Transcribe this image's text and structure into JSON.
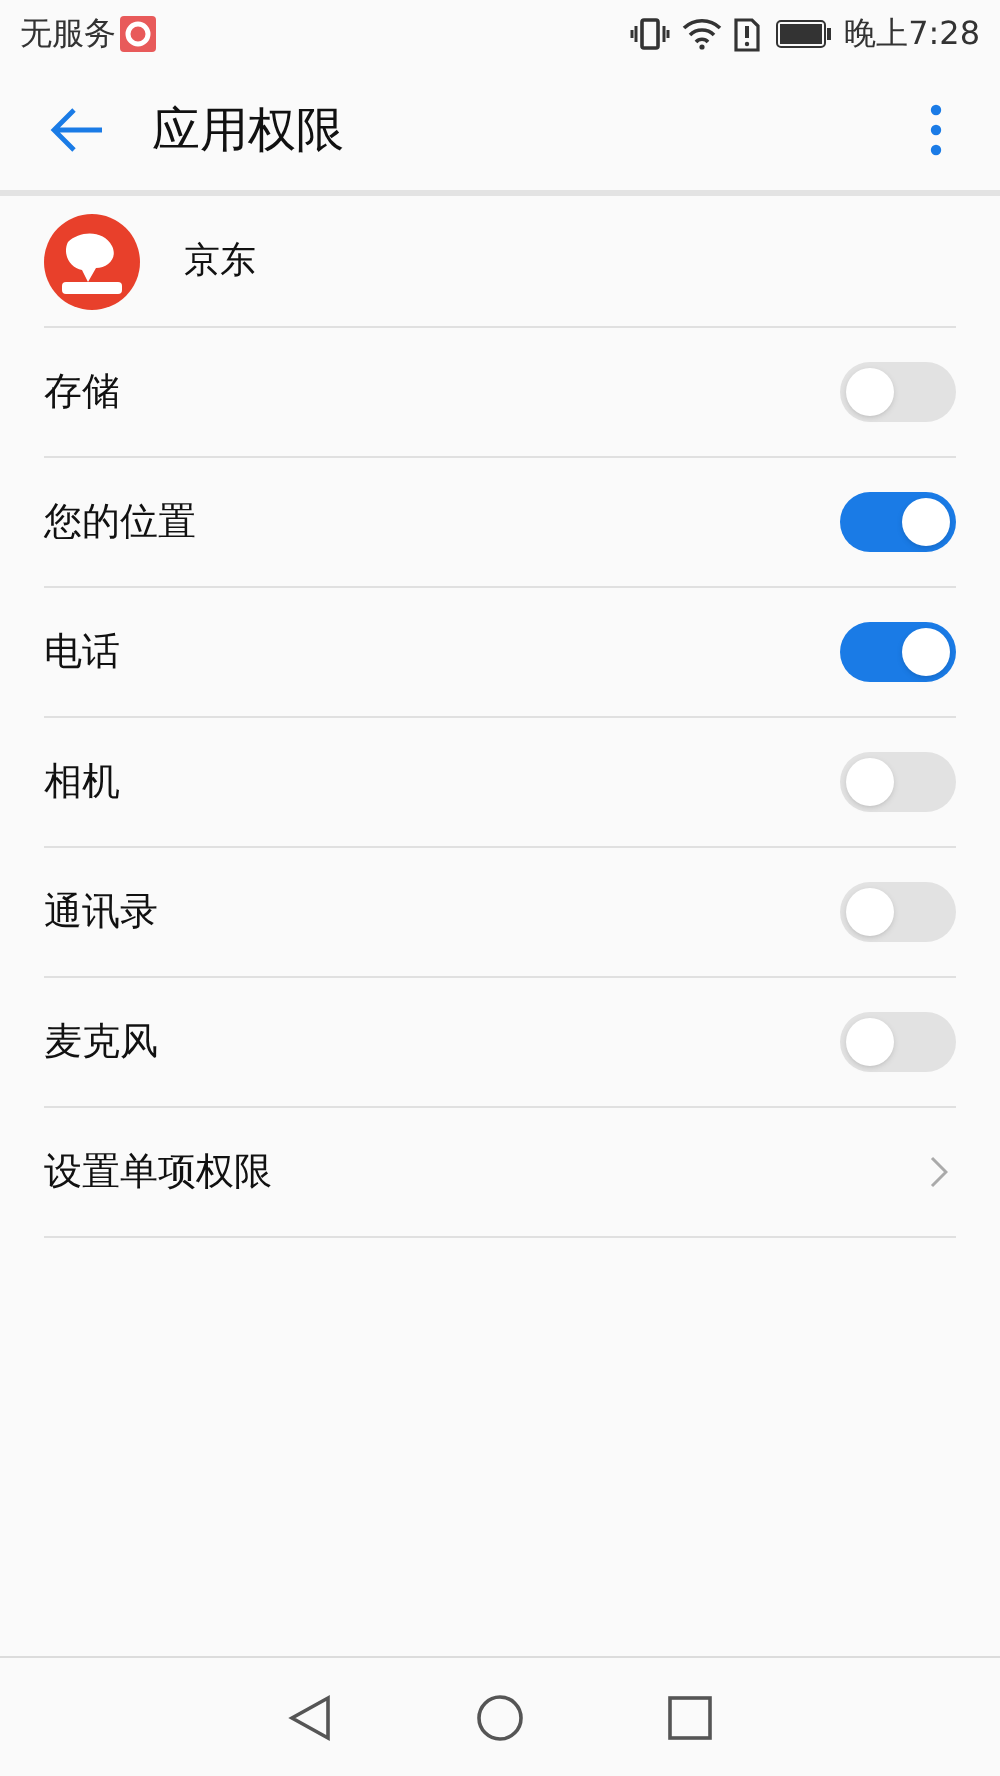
{
  "status_bar": {
    "carrier": "无服务",
    "time": "晚上7:28"
  },
  "header": {
    "title": "应用权限"
  },
  "app": {
    "name": "京东"
  },
  "permissions": [
    {
      "kind": "toggle",
      "label": "存储",
      "on": false
    },
    {
      "kind": "toggle",
      "label": "您的位置",
      "on": true
    },
    {
      "kind": "toggle",
      "label": "电话",
      "on": true
    },
    {
      "kind": "toggle",
      "label": "相机",
      "on": false
    },
    {
      "kind": "toggle",
      "label": "通讯录",
      "on": false
    },
    {
      "kind": "toggle",
      "label": "麦克风",
      "on": false
    },
    {
      "kind": "link",
      "label": "设置单项权限"
    }
  ]
}
